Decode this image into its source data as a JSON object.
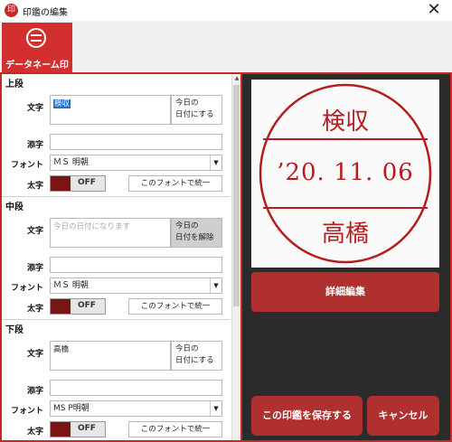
{
  "window": {
    "title": "印鑑の編集",
    "app_icon": "印",
    "close_icon": "✕"
  },
  "toolbar": {
    "tab_label": "データネーム印"
  },
  "labels": {
    "text": "文字",
    "subscript": "添字",
    "font": "フォント",
    "bold": "太字",
    "off": "OFF",
    "unify": "このフォントで統一"
  },
  "sections": [
    {
      "title": "上段",
      "text_value": "検収",
      "today_button": "今日の\n日付にする",
      "font": "ＭＳ 明朝",
      "bold": "OFF"
    },
    {
      "title": "中段",
      "text_placeholder": "今日の日付になります",
      "today_button": "今日の\n日付を解除",
      "font": "ＭＳ 明朝",
      "bold": "OFF"
    },
    {
      "title": "下段",
      "text_value": "高橋",
      "today_button": "今日の\n日付にする",
      "font": "MS P明朝",
      "bold": "OFF"
    }
  ],
  "stamp": {
    "top": "検収",
    "middle": "’20. 11. 06",
    "bottom": "高橋",
    "color": "#b71c1c"
  },
  "buttons": {
    "detail_edit": "詳細編集",
    "save": "この印鑑を保存する",
    "cancel": "キャンセル"
  },
  "colors": {
    "accent": "#d32f2f",
    "panel_dark": "#2b2b2b",
    "button": "#b03030"
  }
}
